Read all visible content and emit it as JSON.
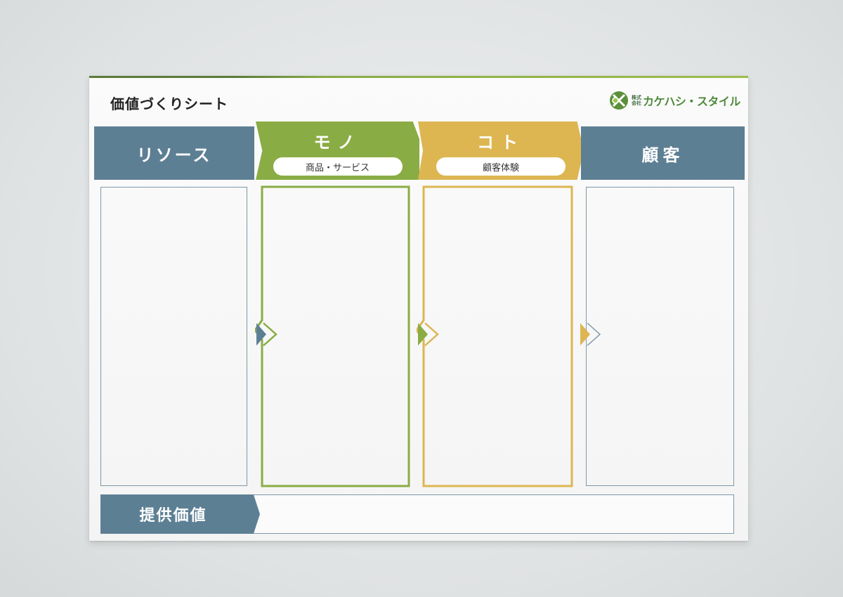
{
  "sheet": {
    "title": "価値づくりシート",
    "logo": {
      "small_line1": "株式",
      "small_line2": "会社",
      "name": "カケハシ・スタイル"
    }
  },
  "columns": {
    "resource": {
      "label": "リソース"
    },
    "mono": {
      "label": "モノ",
      "sub": "商品・サービス"
    },
    "koto": {
      "label": "コト",
      "sub": "顧客体験"
    },
    "customer": {
      "label": "顧客"
    }
  },
  "value_band": {
    "label": "提供価値"
  },
  "colors": {
    "slate": "#5d7f94",
    "green": "#8aac45",
    "gold": "#ddb652"
  }
}
